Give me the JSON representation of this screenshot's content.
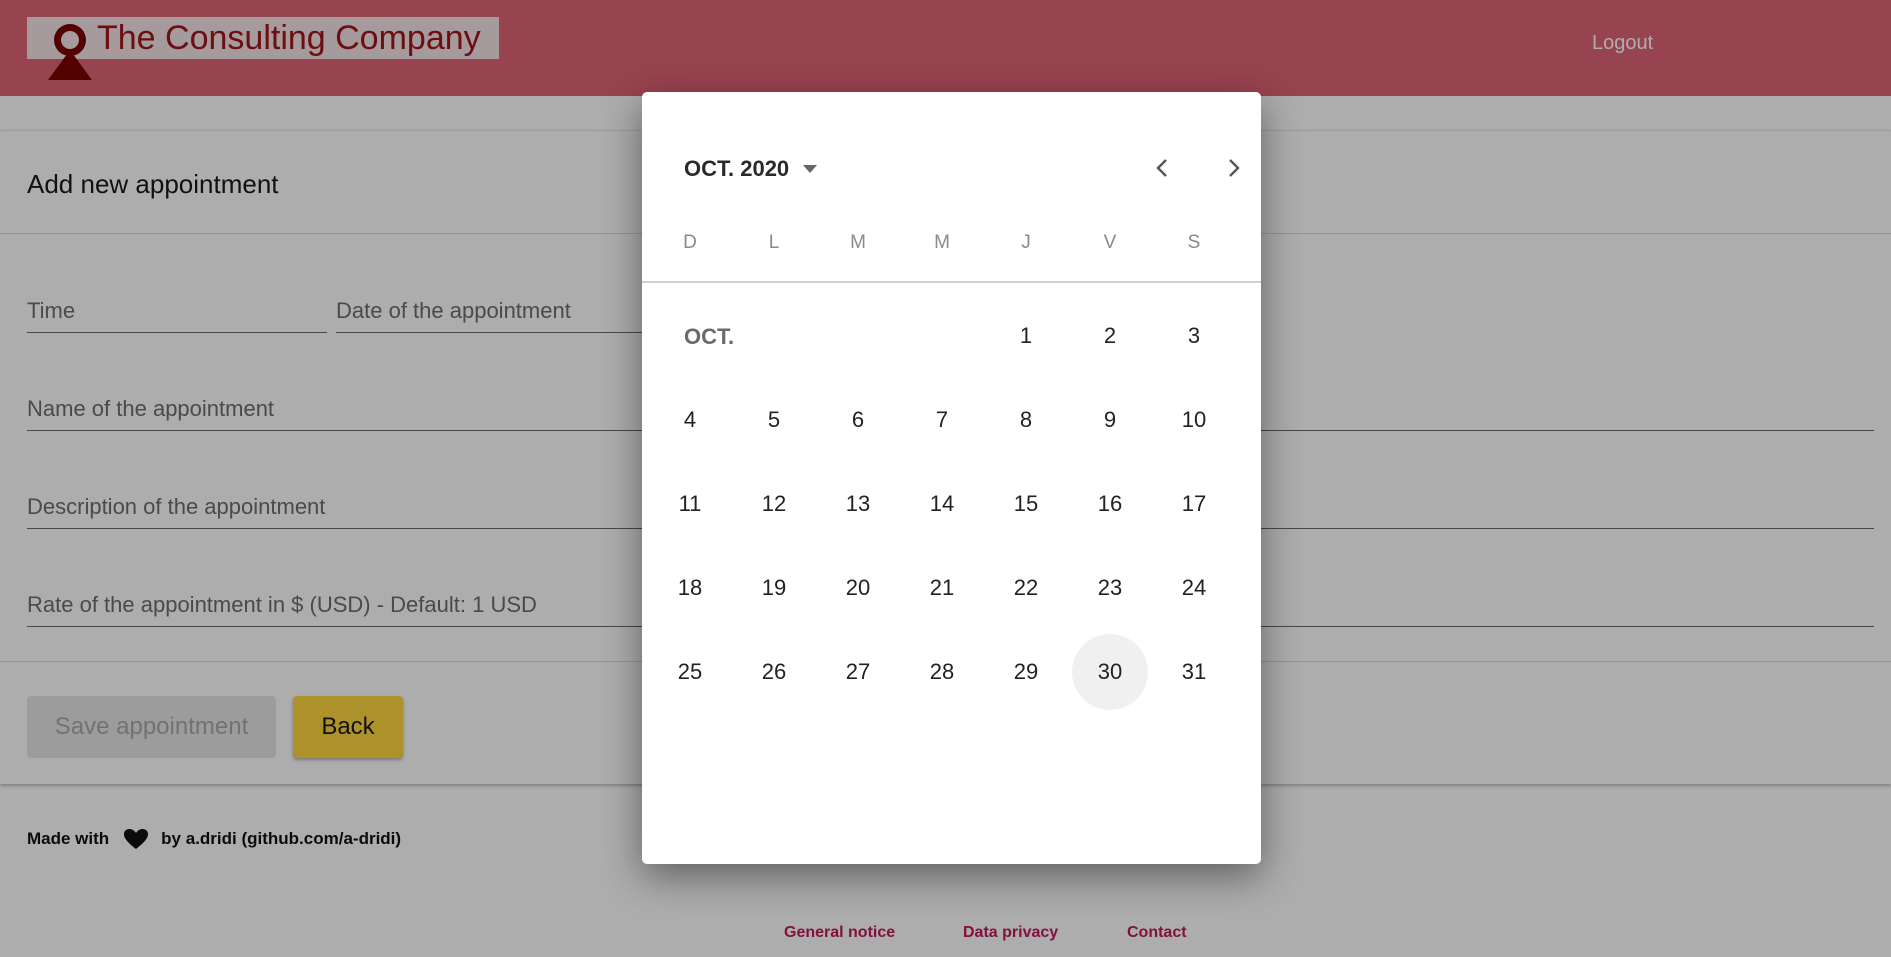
{
  "header": {
    "brand_title": "The Consulting Company",
    "logout_label": "Logout",
    "color": "#e06377"
  },
  "form": {
    "title": "Add new appointment",
    "fields": {
      "time": "Time",
      "date": "Date of the appointment",
      "name": "Name of the appointment",
      "description": "Description of the appointment",
      "rate": "Rate of the appointment in $ (USD) - Default: 1 USD"
    },
    "save_label": "Save appointment",
    "back_label": "Back"
  },
  "footer": {
    "made_with": "Made with",
    "by_text": "by a.dridi (github.com/a-dridi)",
    "links": [
      "General notice",
      "Data privacy",
      "Contact"
    ],
    "link_color": "#c2185b"
  },
  "datepicker": {
    "period_label": "OCT. 2020",
    "weekdays": [
      "D",
      "L",
      "M",
      "M",
      "J",
      "V",
      "S"
    ],
    "month_label": "OCT.",
    "first_weekday_index": 4,
    "days_in_month": 31,
    "highlighted_day": 30,
    "weeks": [
      [
        "",
        "",
        "",
        "",
        "1",
        "2",
        "3"
      ],
      [
        "4",
        "5",
        "6",
        "7",
        "8",
        "9",
        "10"
      ],
      [
        "11",
        "12",
        "13",
        "14",
        "15",
        "16",
        "17"
      ],
      [
        "18",
        "19",
        "20",
        "21",
        "22",
        "23",
        "24"
      ],
      [
        "25",
        "26",
        "27",
        "28",
        "29",
        "30",
        "31"
      ]
    ]
  }
}
